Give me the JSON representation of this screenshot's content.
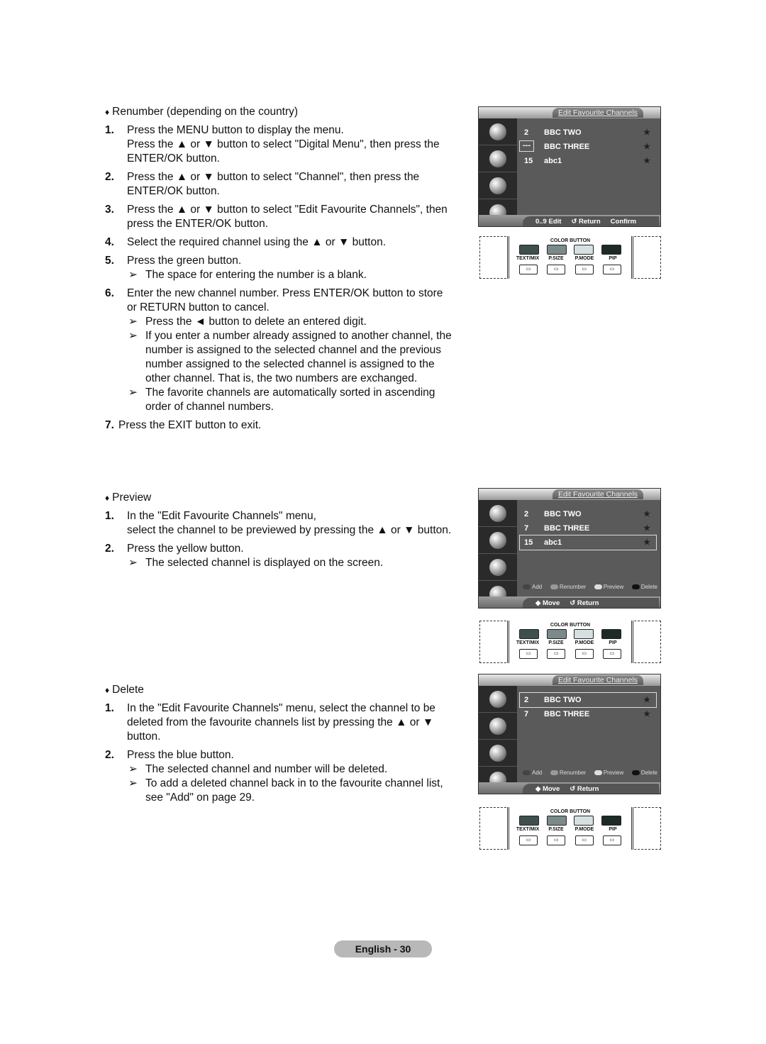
{
  "sections": {
    "renumber": {
      "title": "Renumber (depending on the country)",
      "steps": [
        {
          "num": "1.",
          "lines": [
            "Press the MENU button to display the menu.",
            "Press the ▲ or ▼ button to select \"Digital Menu\", then press the ENTER/OK button."
          ]
        },
        {
          "num": "2.",
          "lines": [
            "Press the ▲ or ▼ button to select \"Channel\", then press the ENTER/OK button."
          ]
        },
        {
          "num": "3.",
          "lines": [
            "Press the ▲ or ▼ button to select \"Edit Favourite Channels\", then press the ENTER/OK button."
          ]
        },
        {
          "num": "4.",
          "lines": [
            "Select the required channel using the ▲ or ▼ button."
          ]
        },
        {
          "num": "5.",
          "lines": [
            "Press the green button."
          ],
          "notes": [
            "The space for entering the number is a blank."
          ]
        },
        {
          "num": "6.",
          "lines": [
            "Enter the new channel number. Press ENTER/OK button to store or RETURN button to cancel."
          ],
          "notes": [
            "Press the ◄ button to delete an entered digit.",
            "If you enter a number already assigned to another channel, the number is assigned to the selected channel and the previous number assigned to the selected channel is assigned to the other channel. That is, the two numbers are exchanged.",
            "The favorite channels are automatically sorted in ascending order of channel numbers."
          ]
        },
        {
          "num": "7.",
          "lines": [
            "Press the EXIT button to exit."
          ]
        }
      ]
    },
    "preview": {
      "title": "Preview",
      "steps": [
        {
          "num": "1.",
          "lines": [
            "In the \"Edit Favourite Channels\" menu,",
            "select the channel to be previewed by pressing the ▲ or ▼ button."
          ]
        },
        {
          "num": "2.",
          "lines": [
            "Press the yellow button."
          ],
          "notes": [
            "The selected channel is displayed on the screen."
          ]
        }
      ]
    },
    "delete": {
      "title": "Delete",
      "steps": [
        {
          "num": "1.",
          "lines": [
            "In the \"Edit Favourite Channels\" menu, select the channel to be deleted from the favourite channels list by pressing the ▲ or ▼ button."
          ]
        },
        {
          "num": "2.",
          "lines": [
            "Press the blue button."
          ],
          "notes": [
            "The selected channel and number will be deleted.",
            "To add a deleted channel back in to the favourite channel list, see \"Add\" on page 29."
          ]
        }
      ]
    }
  },
  "screens": {
    "renumber": {
      "title": "Edit Favourite Channels",
      "rows": [
        {
          "num": "2",
          "name": "BBC TWO",
          "star": "★"
        },
        {
          "num": "---",
          "name": "BBC THREE",
          "star": "★"
        },
        {
          "num": "15",
          "name": "abc1",
          "star": "★"
        }
      ],
      "footer": [
        "0..9 Edit",
        "↺ Return",
        "Confirm"
      ]
    },
    "preview": {
      "title": "Edit Favourite Channels",
      "rows": [
        {
          "num": "2",
          "name": "BBC TWO",
          "star": "★"
        },
        {
          "num": "7",
          "name": "BBC THREE",
          "star": "★"
        },
        {
          "num": "15",
          "name": "abc1",
          "star": "★"
        }
      ],
      "hints": [
        "Add",
        "Renumber",
        "Preview",
        "Delete"
      ],
      "footer": [
        "◆ Move",
        "↺ Return"
      ]
    },
    "delete": {
      "title": "Edit Favourite Channels",
      "rows": [
        {
          "num": "2",
          "name": "BBC TWO",
          "star": "★"
        },
        {
          "num": "7",
          "name": "BBC THREE",
          "star": "★"
        }
      ],
      "hints": [
        "Add",
        "Renumber",
        "Preview",
        "Delete"
      ],
      "footer": [
        "◆ Move",
        "↺ Return"
      ]
    }
  },
  "remote": {
    "color_button_label": "COLOR BUTTON",
    "labels": [
      "TEXT/MIX",
      "P.SIZE",
      "P.MODE",
      "PIP"
    ],
    "button_colors": [
      "#3f4f4d",
      "#7a8a8a",
      "#d6e0e0",
      "#1e2a28"
    ]
  },
  "footer": {
    "page_label": "English - 30"
  }
}
